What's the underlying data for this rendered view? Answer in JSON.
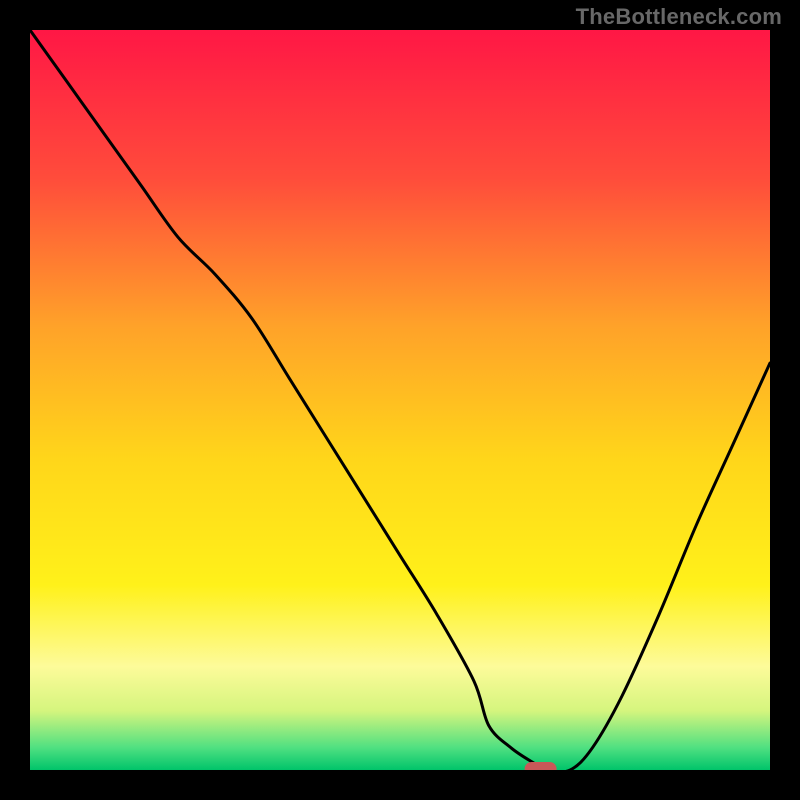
{
  "watermark": "TheBottleneck.com",
  "chart_data": {
    "type": "line",
    "title": "",
    "xlabel": "",
    "ylabel": "",
    "xlim": [
      0,
      100
    ],
    "ylim": [
      0,
      100
    ],
    "x": [
      0,
      5,
      10,
      15,
      20,
      25,
      30,
      35,
      40,
      45,
      50,
      55,
      60,
      62,
      65,
      68,
      70,
      73,
      76,
      80,
      85,
      90,
      95,
      100
    ],
    "values": [
      100,
      93,
      86,
      79,
      72,
      67,
      61,
      53,
      45,
      37,
      29,
      21,
      12,
      6,
      3,
      1,
      0,
      0,
      3,
      10,
      21,
      33,
      44,
      55
    ],
    "marker": {
      "x": 69,
      "y": 0
    },
    "gradient_stops": [
      {
        "offset": 0.0,
        "color": "#ff1745"
      },
      {
        "offset": 0.2,
        "color": "#ff4c3b"
      },
      {
        "offset": 0.4,
        "color": "#ffa229"
      },
      {
        "offset": 0.58,
        "color": "#ffd61a"
      },
      {
        "offset": 0.75,
        "color": "#fff11a"
      },
      {
        "offset": 0.86,
        "color": "#fdfb9a"
      },
      {
        "offset": 0.92,
        "color": "#d5f57e"
      },
      {
        "offset": 0.97,
        "color": "#4fe081"
      },
      {
        "offset": 1.0,
        "color": "#00c46a"
      }
    ],
    "marker_color": "#c95858",
    "curve_color": "#000000"
  }
}
